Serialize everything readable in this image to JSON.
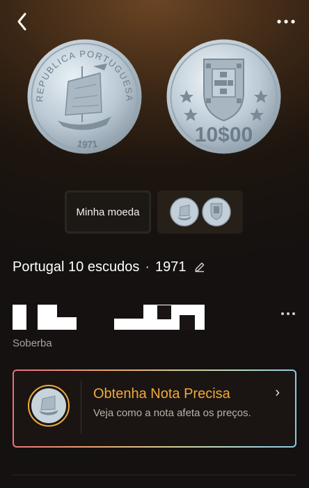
{
  "header": {
    "back_icon": "chevron-left-icon",
    "more_icon": "ellipsis-icon"
  },
  "coin": {
    "obverse_legend": "REPUBLICA PORTUGUESA",
    "obverse_year": "1971",
    "reverse_value": "10$00"
  },
  "selector": {
    "mine_label": "Minha moeda"
  },
  "title": {
    "country_denom": "Portugal 10 escudos",
    "separator": "·",
    "year": "1971"
  },
  "grade": {
    "label": "Soberba"
  },
  "card": {
    "title": "Obtenha Nota Precisa",
    "text": "Veja como a nota afeta os preços.",
    "chevron": "›"
  },
  "colors": {
    "accent": "#f0a93a",
    "background": "#1d150f"
  }
}
